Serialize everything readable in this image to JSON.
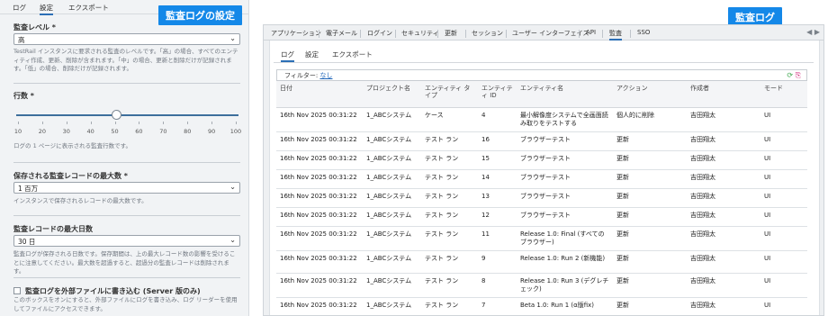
{
  "left_panel": {
    "tabs": [
      "ログ",
      "設定",
      "エクスポート"
    ],
    "active_tab": "設定",
    "badge": "監査ログの設定",
    "audit_level": {
      "label": "監査レベル *",
      "value": "高",
      "help": "TestRail インスタンスに要求される監査のレベルです。「高」の場合、すべてのエンティティ作成、更新、削除が含まれます。「中」の場合、更新と削除だけが記録されます。「低」の場合、削除だけが記録されます。"
    },
    "rows": {
      "label": "行数 *",
      "slider_value": 50,
      "ticks": [
        "10",
        "20",
        "30",
        "40",
        "50",
        "60",
        "70",
        "80",
        "90",
        "100"
      ],
      "help": "ログの 1 ページに表示される監査行数です。"
    },
    "max_records": {
      "label": "保存される監査レコードの最大数 *",
      "value": "1 百万",
      "help": "インスタンスで保存されるレコードの最大数です。"
    },
    "max_days": {
      "label": "監査レコードの最大日数",
      "value": "30 日",
      "help": "監査ログが保存される日数です。保存期間は、上の最大レコード数の影響を受けることに注意してください。最大数を超過すると、超過分の監査レコードは削除されます。"
    },
    "write_file": {
      "label": "監査ログを外部ファイルに書き込む (Server 版のみ)",
      "help": "このボックスをオンにすると、外部ファイルにログを書き込み、ログ リーダーを使用してファイルにアクセスできます。"
    }
  },
  "right_panel": {
    "badge": "監査ログ",
    "top_tabs": [
      "アプリケーション",
      "電子メール",
      "ログイン",
      "セキュリティ",
      "更新",
      "セッション",
      "ユーザー インターフェイス",
      "API",
      "監査",
      "SSO"
    ],
    "active_top_tab": "監査",
    "sub_tabs": [
      "ログ",
      "設定",
      "エクスポート"
    ],
    "active_sub_tab": "ログ",
    "filter_label": "フィルター:",
    "filter_value": "なし",
    "columns": [
      "日付",
      "プロジェクト名",
      "エンティティ タイプ",
      "エンティティ ID",
      "エンティティ名",
      "アクション",
      "作成者",
      "モード"
    ],
    "rows": [
      [
        "16th Nov 2025 00:31:22",
        "1_ABCシステム",
        "ケース",
        "4",
        "最小解像度システムで全画面読み取りをテストする",
        "個人的に削除",
        "吉田翔太",
        "UI"
      ],
      [
        "16th Nov 2025 00:31:22",
        "1_ABCシステム",
        "テスト ラン",
        "16",
        "ブラウザーテスト",
        "更新",
        "吉田翔太",
        "UI"
      ],
      [
        "16th Nov 2025 00:31:22",
        "1_ABCシステム",
        "テスト ラン",
        "15",
        "ブラウザーテスト",
        "更新",
        "吉田翔太",
        "UI"
      ],
      [
        "16th Nov 2025 00:31:22",
        "1_ABCシステム",
        "テスト ラン",
        "14",
        "ブラウザーテスト",
        "更新",
        "吉田翔太",
        "UI"
      ],
      [
        "16th Nov 2025 00:31:22",
        "1_ABCシステム",
        "テスト ラン",
        "13",
        "ブラウザーテスト",
        "更新",
        "吉田翔太",
        "UI"
      ],
      [
        "16th Nov 2025 00:31:22",
        "1_ABCシステム",
        "テスト ラン",
        "12",
        "ブラウザーテスト",
        "更新",
        "吉田翔太",
        "UI"
      ],
      [
        "16th Nov 2025 00:31:22",
        "1_ABCシステム",
        "テスト ラン",
        "11",
        "Release 1.0: Final (すべてのブラウザー)",
        "更新",
        "吉田翔太",
        "UI"
      ],
      [
        "16th Nov 2025 00:31:22",
        "1_ABCシステム",
        "テスト ラン",
        "9",
        "Release 1.0: Run 2 (新機能)",
        "更新",
        "吉田翔太",
        "UI"
      ],
      [
        "16th Nov 2025 00:31:22",
        "1_ABCシステム",
        "テスト ラン",
        "8",
        "Release 1.0: Run 3 (デグレチェック)",
        "更新",
        "吉田翔太",
        "UI"
      ],
      [
        "16th Nov 2025 00:31:22",
        "1_ABCシステム",
        "テスト ラン",
        "7",
        "Beta 1.0: Run 1 (α版fix)",
        "更新",
        "吉田翔太",
        "UI"
      ]
    ]
  },
  "colors": {
    "accent": "#1488e8",
    "link": "#1a62b8",
    "tab_underline": "#2c6fb6"
  }
}
